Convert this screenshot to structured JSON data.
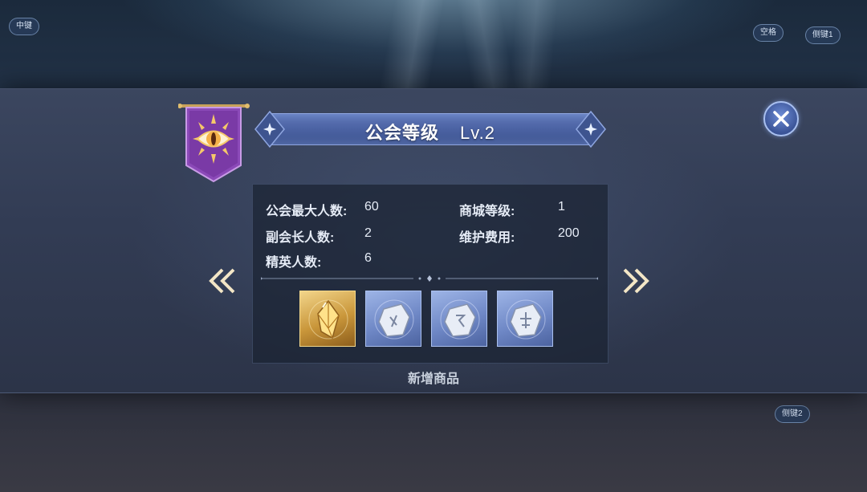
{
  "key_hints": {
    "middle": "中键",
    "space": "空格",
    "side1": "侧键1",
    "side2": "侧键2"
  },
  "title": {
    "name": "公会等级",
    "level": "Lv.2"
  },
  "stats": {
    "left": [
      {
        "label": "公会最大人数:",
        "value": "60"
      },
      {
        "label": "副会长人数:",
        "value": "2"
      },
      {
        "label": "精英人数:",
        "value": "6"
      }
    ],
    "right": [
      {
        "label": "商城等级:",
        "value": "1"
      },
      {
        "label": "维护费用:",
        "value": "200"
      }
    ]
  },
  "items": [
    {
      "name": "gold-crystal",
      "rarity": "gold"
    },
    {
      "name": "silver-rune-stone",
      "rarity": "silver"
    },
    {
      "name": "silver-rune-stone",
      "rarity": "silver"
    },
    {
      "name": "silver-rune-stone",
      "rarity": "silver"
    }
  ],
  "new_items_label": "新增商品",
  "icons": {
    "banner": "eye-banner-icon",
    "close": "close-icon",
    "prev": "double-chevron-left-icon",
    "next": "double-chevron-right-icon"
  },
  "colors": {
    "banner_purple": "#8b49b8",
    "title_bar_blue": "#4b62a3",
    "arrow_cream": "#f3e6c6"
  }
}
